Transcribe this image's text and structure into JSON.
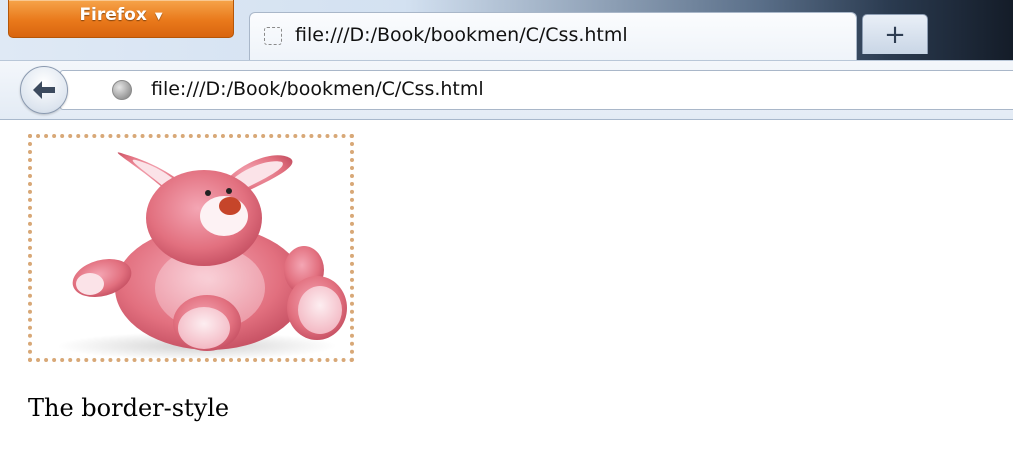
{
  "browser": {
    "menu_button_label": "Firefox",
    "menu_button_caret": "▼",
    "tab": {
      "title": "file:///D:/Book/bookmen/C/Css.html"
    },
    "new_tab_label": "+",
    "url": "file:///D:/Book/bookmen/C/Css.html"
  },
  "page": {
    "image": {
      "depicts": "pink plush bunny toy",
      "border_color": "#d8a877",
      "border_style": "dotted"
    },
    "caption": "The border-style"
  },
  "colors": {
    "firefox_button": "#e9791b",
    "accent_dark": "#141c28",
    "toolbar": "#e3ebf5"
  }
}
